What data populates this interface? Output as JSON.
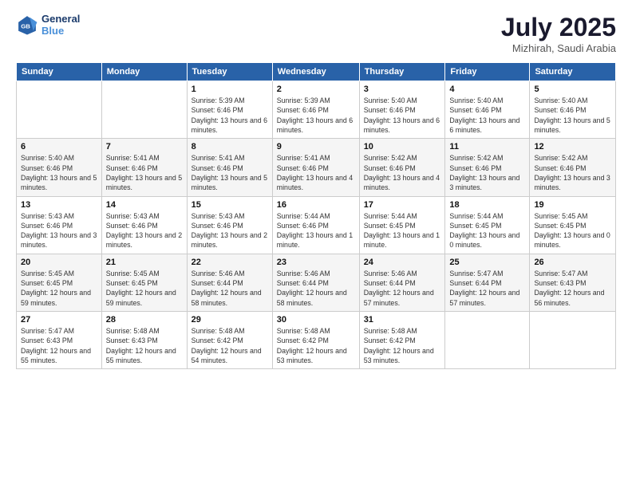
{
  "header": {
    "logo_line1": "General",
    "logo_line2": "Blue",
    "month_title": "July 2025",
    "location": "Mizhirah, Saudi Arabia"
  },
  "days_of_week": [
    "Sunday",
    "Monday",
    "Tuesday",
    "Wednesday",
    "Thursday",
    "Friday",
    "Saturday"
  ],
  "weeks": [
    [
      {
        "day": "",
        "info": ""
      },
      {
        "day": "",
        "info": ""
      },
      {
        "day": "1",
        "info": "Sunrise: 5:39 AM\nSunset: 6:46 PM\nDaylight: 13 hours and 6 minutes."
      },
      {
        "day": "2",
        "info": "Sunrise: 5:39 AM\nSunset: 6:46 PM\nDaylight: 13 hours and 6 minutes."
      },
      {
        "day": "3",
        "info": "Sunrise: 5:40 AM\nSunset: 6:46 PM\nDaylight: 13 hours and 6 minutes."
      },
      {
        "day": "4",
        "info": "Sunrise: 5:40 AM\nSunset: 6:46 PM\nDaylight: 13 hours and 6 minutes."
      },
      {
        "day": "5",
        "info": "Sunrise: 5:40 AM\nSunset: 6:46 PM\nDaylight: 13 hours and 5 minutes."
      }
    ],
    [
      {
        "day": "6",
        "info": "Sunrise: 5:40 AM\nSunset: 6:46 PM\nDaylight: 13 hours and 5 minutes."
      },
      {
        "day": "7",
        "info": "Sunrise: 5:41 AM\nSunset: 6:46 PM\nDaylight: 13 hours and 5 minutes."
      },
      {
        "day": "8",
        "info": "Sunrise: 5:41 AM\nSunset: 6:46 PM\nDaylight: 13 hours and 5 minutes."
      },
      {
        "day": "9",
        "info": "Sunrise: 5:41 AM\nSunset: 6:46 PM\nDaylight: 13 hours and 4 minutes."
      },
      {
        "day": "10",
        "info": "Sunrise: 5:42 AM\nSunset: 6:46 PM\nDaylight: 13 hours and 4 minutes."
      },
      {
        "day": "11",
        "info": "Sunrise: 5:42 AM\nSunset: 6:46 PM\nDaylight: 13 hours and 3 minutes."
      },
      {
        "day": "12",
        "info": "Sunrise: 5:42 AM\nSunset: 6:46 PM\nDaylight: 13 hours and 3 minutes."
      }
    ],
    [
      {
        "day": "13",
        "info": "Sunrise: 5:43 AM\nSunset: 6:46 PM\nDaylight: 13 hours and 3 minutes."
      },
      {
        "day": "14",
        "info": "Sunrise: 5:43 AM\nSunset: 6:46 PM\nDaylight: 13 hours and 2 minutes."
      },
      {
        "day": "15",
        "info": "Sunrise: 5:43 AM\nSunset: 6:46 PM\nDaylight: 13 hours and 2 minutes."
      },
      {
        "day": "16",
        "info": "Sunrise: 5:44 AM\nSunset: 6:46 PM\nDaylight: 13 hours and 1 minute."
      },
      {
        "day": "17",
        "info": "Sunrise: 5:44 AM\nSunset: 6:45 PM\nDaylight: 13 hours and 1 minute."
      },
      {
        "day": "18",
        "info": "Sunrise: 5:44 AM\nSunset: 6:45 PM\nDaylight: 13 hours and 0 minutes."
      },
      {
        "day": "19",
        "info": "Sunrise: 5:45 AM\nSunset: 6:45 PM\nDaylight: 13 hours and 0 minutes."
      }
    ],
    [
      {
        "day": "20",
        "info": "Sunrise: 5:45 AM\nSunset: 6:45 PM\nDaylight: 12 hours and 59 minutes."
      },
      {
        "day": "21",
        "info": "Sunrise: 5:45 AM\nSunset: 6:45 PM\nDaylight: 12 hours and 59 minutes."
      },
      {
        "day": "22",
        "info": "Sunrise: 5:46 AM\nSunset: 6:44 PM\nDaylight: 12 hours and 58 minutes."
      },
      {
        "day": "23",
        "info": "Sunrise: 5:46 AM\nSunset: 6:44 PM\nDaylight: 12 hours and 58 minutes."
      },
      {
        "day": "24",
        "info": "Sunrise: 5:46 AM\nSunset: 6:44 PM\nDaylight: 12 hours and 57 minutes."
      },
      {
        "day": "25",
        "info": "Sunrise: 5:47 AM\nSunset: 6:44 PM\nDaylight: 12 hours and 57 minutes."
      },
      {
        "day": "26",
        "info": "Sunrise: 5:47 AM\nSunset: 6:43 PM\nDaylight: 12 hours and 56 minutes."
      }
    ],
    [
      {
        "day": "27",
        "info": "Sunrise: 5:47 AM\nSunset: 6:43 PM\nDaylight: 12 hours and 55 minutes."
      },
      {
        "day": "28",
        "info": "Sunrise: 5:48 AM\nSunset: 6:43 PM\nDaylight: 12 hours and 55 minutes."
      },
      {
        "day": "29",
        "info": "Sunrise: 5:48 AM\nSunset: 6:42 PM\nDaylight: 12 hours and 54 minutes."
      },
      {
        "day": "30",
        "info": "Sunrise: 5:48 AM\nSunset: 6:42 PM\nDaylight: 12 hours and 53 minutes."
      },
      {
        "day": "31",
        "info": "Sunrise: 5:48 AM\nSunset: 6:42 PM\nDaylight: 12 hours and 53 minutes."
      },
      {
        "day": "",
        "info": ""
      },
      {
        "day": "",
        "info": ""
      }
    ]
  ]
}
